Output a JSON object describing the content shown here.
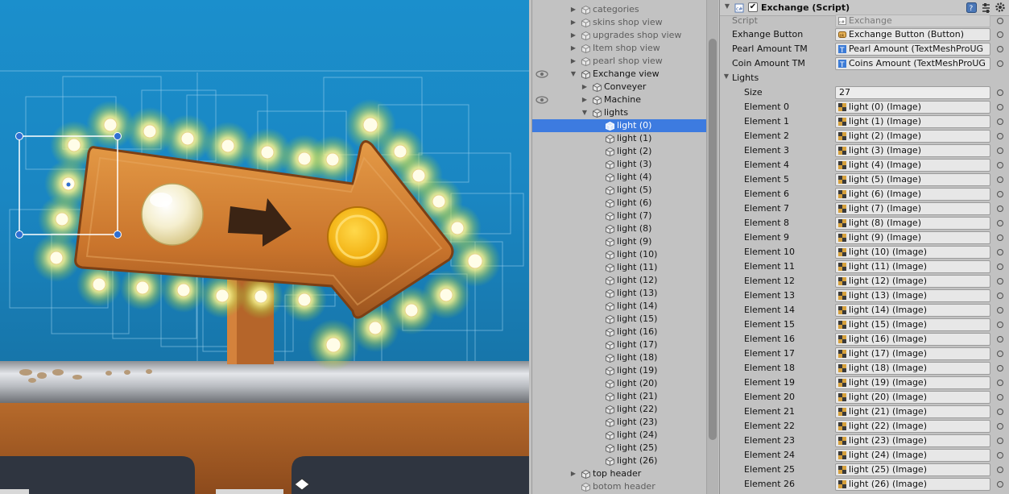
{
  "hierarchy": {
    "rows": [
      {
        "label": "categories",
        "indent": 1,
        "arrow": "right",
        "dim": true
      },
      {
        "label": "skins shop view",
        "indent": 1,
        "arrow": "right",
        "dim": true
      },
      {
        "label": "upgrades shop view",
        "indent": 1,
        "arrow": "right",
        "dim": true
      },
      {
        "label": "Item shop view",
        "indent": 1,
        "arrow": "right",
        "dim": true
      },
      {
        "label": "pearl shop view",
        "indent": 1,
        "arrow": "right",
        "dim": true
      },
      {
        "label": "Exchange view",
        "indent": 1,
        "arrow": "down",
        "dim": false,
        "eye": true
      },
      {
        "label": "Conveyer",
        "indent": 2,
        "arrow": "right",
        "dim": false
      },
      {
        "label": "Machine",
        "indent": 2,
        "arrow": "right",
        "dim": false,
        "eye": true
      },
      {
        "label": "lights",
        "indent": 2,
        "arrow": "down",
        "dim": false
      },
      {
        "label": "light (0)",
        "indent": 3,
        "arrow": "",
        "dim": false,
        "selected": true
      },
      {
        "label": "light (1)",
        "indent": 3,
        "arrow": "",
        "dim": false
      },
      {
        "label": "light (2)",
        "indent": 3,
        "arrow": "",
        "dim": false
      },
      {
        "label": "light (3)",
        "indent": 3,
        "arrow": "",
        "dim": false
      },
      {
        "label": "light (4)",
        "indent": 3,
        "arrow": "",
        "dim": false
      },
      {
        "label": "light (5)",
        "indent": 3,
        "arrow": "",
        "dim": false
      },
      {
        "label": "light (6)",
        "indent": 3,
        "arrow": "",
        "dim": false
      },
      {
        "label": "light (7)",
        "indent": 3,
        "arrow": "",
        "dim": false
      },
      {
        "label": "light (8)",
        "indent": 3,
        "arrow": "",
        "dim": false
      },
      {
        "label": "light (9)",
        "indent": 3,
        "arrow": "",
        "dim": false
      },
      {
        "label": "light (10)",
        "indent": 3,
        "arrow": "",
        "dim": false
      },
      {
        "label": "light (11)",
        "indent": 3,
        "arrow": "",
        "dim": false
      },
      {
        "label": "light (12)",
        "indent": 3,
        "arrow": "",
        "dim": false
      },
      {
        "label": "light (13)",
        "indent": 3,
        "arrow": "",
        "dim": false
      },
      {
        "label": "light (14)",
        "indent": 3,
        "arrow": "",
        "dim": false
      },
      {
        "label": "light (15)",
        "indent": 3,
        "arrow": "",
        "dim": false
      },
      {
        "label": "light (16)",
        "indent": 3,
        "arrow": "",
        "dim": false
      },
      {
        "label": "light (17)",
        "indent": 3,
        "arrow": "",
        "dim": false
      },
      {
        "label": "light (18)",
        "indent": 3,
        "arrow": "",
        "dim": false
      },
      {
        "label": "light (19)",
        "indent": 3,
        "arrow": "",
        "dim": false
      },
      {
        "label": "light (20)",
        "indent": 3,
        "arrow": "",
        "dim": false
      },
      {
        "label": "light (21)",
        "indent": 3,
        "arrow": "",
        "dim": false
      },
      {
        "label": "light (22)",
        "indent": 3,
        "arrow": "",
        "dim": false
      },
      {
        "label": "light (23)",
        "indent": 3,
        "arrow": "",
        "dim": false
      },
      {
        "label": "light (24)",
        "indent": 3,
        "arrow": "",
        "dim": false
      },
      {
        "label": "light (25)",
        "indent": 3,
        "arrow": "",
        "dim": false
      },
      {
        "label": "light (26)",
        "indent": 3,
        "arrow": "",
        "dim": false
      },
      {
        "label": "top header",
        "indent": 1,
        "arrow": "right",
        "dim": false
      },
      {
        "label": "botom header",
        "indent": 1,
        "arrow": "",
        "dim": true
      }
    ]
  },
  "inspector": {
    "component_title": "Exchange (Script)",
    "component_enabled": true,
    "script_label": "Script",
    "script_value": "Exchange",
    "exchange_button_label": "Exhange Button",
    "exchange_button_value": "Exchange Button (Button)",
    "pearl_label": "Pearl Amount TM",
    "pearl_value": "Pearl Amount (TextMeshProUG",
    "coin_label": "Coin Amount TM",
    "coin_value": "Coins Amount (TextMeshProUG",
    "lights_label": "Lights",
    "size_label": "Size",
    "size_value": "27",
    "elements": [
      {
        "label": "Element 0",
        "value": "light (0) (Image)"
      },
      {
        "label": "Element 1",
        "value": "light (1) (Image)"
      },
      {
        "label": "Element 2",
        "value": "light (2) (Image)"
      },
      {
        "label": "Element 3",
        "value": "light (3) (Image)"
      },
      {
        "label": "Element 4",
        "value": "light (4) (Image)"
      },
      {
        "label": "Element 5",
        "value": "light (5) (Image)"
      },
      {
        "label": "Element 6",
        "value": "light (6) (Image)"
      },
      {
        "label": "Element 7",
        "value": "light (7) (Image)"
      },
      {
        "label": "Element 8",
        "value": "light (8) (Image)"
      },
      {
        "label": "Element 9",
        "value": "light (9) (Image)"
      },
      {
        "label": "Element 10",
        "value": "light (10) (Image)"
      },
      {
        "label": "Element 11",
        "value": "light (11) (Image)"
      },
      {
        "label": "Element 12",
        "value": "light (12) (Image)"
      },
      {
        "label": "Element 13",
        "value": "light (13) (Image)"
      },
      {
        "label": "Element 14",
        "value": "light (14) (Image)"
      },
      {
        "label": "Element 15",
        "value": "light (15) (Image)"
      },
      {
        "label": "Element 16",
        "value": "light (16) (Image)"
      },
      {
        "label": "Element 17",
        "value": "light (17) (Image)"
      },
      {
        "label": "Element 18",
        "value": "light (18) (Image)"
      },
      {
        "label": "Element 19",
        "value": "light (19) (Image)"
      },
      {
        "label": "Element 20",
        "value": "light (20) (Image)"
      },
      {
        "label": "Element 21",
        "value": "light (21) (Image)"
      },
      {
        "label": "Element 22",
        "value": "light (22) (Image)"
      },
      {
        "label": "Element 23",
        "value": "light (23) (Image)"
      },
      {
        "label": "Element 24",
        "value": "light (24) (Image)"
      },
      {
        "label": "Element 25",
        "value": "light (25) (Image)"
      },
      {
        "label": "Element 26",
        "value": "light (26) (Image)"
      }
    ]
  },
  "colors": {
    "selection": "#3d7be0",
    "scene_sky": "#1a86c2",
    "wood": "#c8772e",
    "coin": "#f3b416",
    "pearl": "#f7f1d6"
  }
}
